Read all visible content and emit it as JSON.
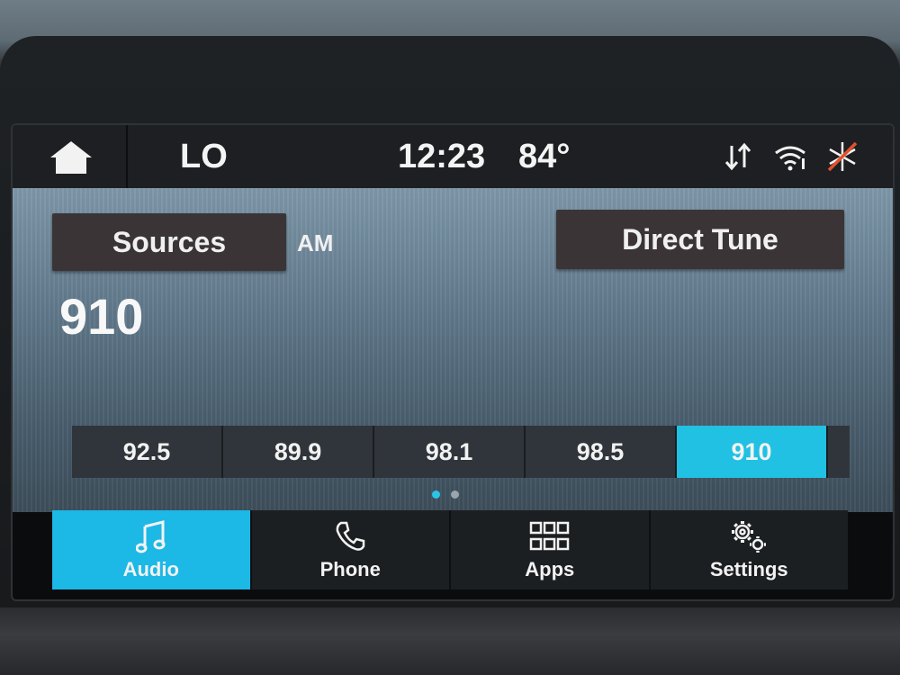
{
  "status_bar": {
    "home_icon": "home-icon",
    "climate_label": "LO",
    "time": "12:23",
    "temperature": "84°",
    "icons": [
      "data-transfer-icon",
      "wifi-icon",
      "climate-off-icon"
    ]
  },
  "radio": {
    "sources_label": "Sources",
    "band": "AM",
    "direct_tune_label": "Direct Tune",
    "current_frequency": "910",
    "presets": [
      {
        "label": "92.5",
        "active": false
      },
      {
        "label": "89.9",
        "active": false
      },
      {
        "label": "98.1",
        "active": false
      },
      {
        "label": "98.5",
        "active": false
      },
      {
        "label": "910",
        "active": true
      }
    ],
    "page_count": 2,
    "current_page": 1
  },
  "nav": {
    "items": [
      {
        "label": "Audio",
        "icon": "music-note-icon",
        "active": true
      },
      {
        "label": "Phone",
        "icon": "phone-icon",
        "active": false
      },
      {
        "label": "Apps",
        "icon": "apps-grid-icon",
        "active": false
      },
      {
        "label": "Settings",
        "icon": "gear-icon",
        "active": false
      }
    ]
  },
  "colors": {
    "accent": "#1cb8e6",
    "button_dark": "#3b3436",
    "status_bar": "#1d1f22"
  }
}
